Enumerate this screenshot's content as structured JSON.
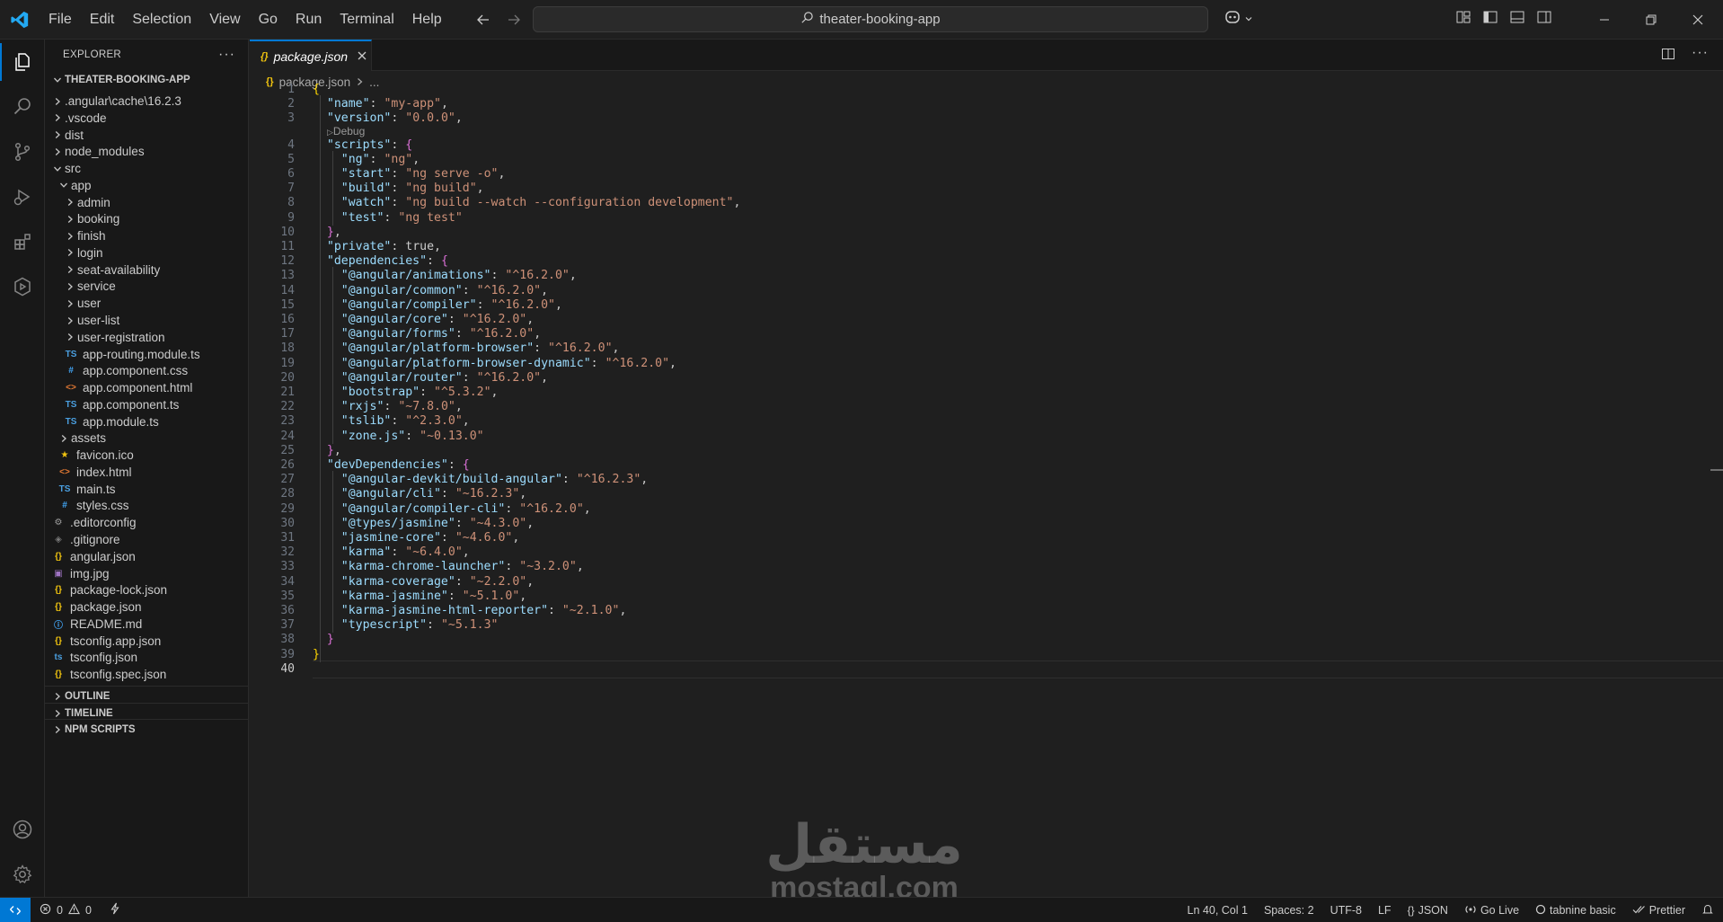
{
  "menu": [
    "File",
    "Edit",
    "Selection",
    "View",
    "Go",
    "Run",
    "Terminal",
    "Help"
  ],
  "command_center": {
    "text": "theater-booking-app"
  },
  "explorer": {
    "title": "EXPLORER",
    "root": "THEATER-BOOKING-APP",
    "tree": [
      {
        "label": ".angular\\cache\\16.2.3",
        "depth": 0,
        "kind": "folder",
        "open": false
      },
      {
        "label": ".vscode",
        "depth": 0,
        "kind": "folder",
        "open": false
      },
      {
        "label": "dist",
        "depth": 0,
        "kind": "folder",
        "open": false
      },
      {
        "label": "node_modules",
        "depth": 0,
        "kind": "folder",
        "open": false
      },
      {
        "label": "src",
        "depth": 0,
        "kind": "folder",
        "open": true
      },
      {
        "label": "app",
        "depth": 1,
        "kind": "folder",
        "open": true
      },
      {
        "label": "admin",
        "depth": 2,
        "kind": "folder",
        "open": false
      },
      {
        "label": "booking",
        "depth": 2,
        "kind": "folder",
        "open": false
      },
      {
        "label": "finish",
        "depth": 2,
        "kind": "folder",
        "open": false
      },
      {
        "label": "login",
        "depth": 2,
        "kind": "folder",
        "open": false
      },
      {
        "label": "seat-availability",
        "depth": 2,
        "kind": "folder",
        "open": false
      },
      {
        "label": "service",
        "depth": 2,
        "kind": "folder",
        "open": false
      },
      {
        "label": "user",
        "depth": 2,
        "kind": "folder",
        "open": false
      },
      {
        "label": "user-list",
        "depth": 2,
        "kind": "folder",
        "open": false
      },
      {
        "label": "user-registration",
        "depth": 2,
        "kind": "folder",
        "open": false
      },
      {
        "label": "app-routing.module.ts",
        "depth": 2,
        "kind": "ts"
      },
      {
        "label": "app.component.css",
        "depth": 2,
        "kind": "css"
      },
      {
        "label": "app.component.html",
        "depth": 2,
        "kind": "html"
      },
      {
        "label": "app.component.ts",
        "depth": 2,
        "kind": "ts"
      },
      {
        "label": "app.module.ts",
        "depth": 2,
        "kind": "ts"
      },
      {
        "label": "assets",
        "depth": 1,
        "kind": "folder",
        "open": false
      },
      {
        "label": "favicon.ico",
        "depth": 1,
        "kind": "star"
      },
      {
        "label": "index.html",
        "depth": 1,
        "kind": "html"
      },
      {
        "label": "main.ts",
        "depth": 1,
        "kind": "ts"
      },
      {
        "label": "styles.css",
        "depth": 1,
        "kind": "css"
      },
      {
        "label": ".editorconfig",
        "depth": 0,
        "kind": "gear"
      },
      {
        "label": ".gitignore",
        "depth": 0,
        "kind": "git"
      },
      {
        "label": "angular.json",
        "depth": 0,
        "kind": "json"
      },
      {
        "label": "img.jpg",
        "depth": 0,
        "kind": "img"
      },
      {
        "label": "package-lock.json",
        "depth": 0,
        "kind": "json"
      },
      {
        "label": "package.json",
        "depth": 0,
        "kind": "json"
      },
      {
        "label": "README.md",
        "depth": 0,
        "kind": "info"
      },
      {
        "label": "tsconfig.app.json",
        "depth": 0,
        "kind": "json"
      },
      {
        "label": "tsconfig.json",
        "depth": 0,
        "kind": "tsconfig"
      },
      {
        "label": "tsconfig.spec.json",
        "depth": 0,
        "kind": "json"
      }
    ],
    "sections": [
      "OUTLINE",
      "TIMELINE",
      "NPM SCRIPTS"
    ]
  },
  "tab": {
    "label": "package.json"
  },
  "breadcrumb": {
    "file": "package.json",
    "more": "..."
  },
  "codelens": "Debug",
  "code": [
    "{",
    "  \"name\": \"my-app\",",
    "  \"version\": \"0.0.0\",",
    "  \"scripts\": {",
    "    \"ng\": \"ng\",",
    "    \"start\": \"ng serve -o\",",
    "    \"build\": \"ng build\",",
    "    \"watch\": \"ng build --watch --configuration development\",",
    "    \"test\": \"ng test\"",
    "  },",
    "  \"private\": true,",
    "  \"dependencies\": {",
    "    \"@angular/animations\": \"^16.2.0\",",
    "    \"@angular/common\": \"^16.2.0\",",
    "    \"@angular/compiler\": \"^16.2.0\",",
    "    \"@angular/core\": \"^16.2.0\",",
    "    \"@angular/forms\": \"^16.2.0\",",
    "    \"@angular/platform-browser\": \"^16.2.0\",",
    "    \"@angular/platform-browser-dynamic\": \"^16.2.0\",",
    "    \"@angular/router\": \"^16.2.0\",",
    "    \"bootstrap\": \"^5.3.2\",",
    "    \"rxjs\": \"~7.8.0\",",
    "    \"tslib\": \"^2.3.0\",",
    "    \"zone.js\": \"~0.13.0\"",
    "  },",
    "  \"devDependencies\": {",
    "    \"@angular-devkit/build-angular\": \"^16.2.3\",",
    "    \"@angular/cli\": \"~16.2.3\",",
    "    \"@angular/compiler-cli\": \"^16.2.0\",",
    "    \"@types/jasmine\": \"~4.3.0\",",
    "    \"jasmine-core\": \"~4.6.0\",",
    "    \"karma\": \"~6.4.0\",",
    "    \"karma-chrome-launcher\": \"~3.2.0\",",
    "    \"karma-coverage\": \"~2.2.0\",",
    "    \"karma-jasmine\": \"~5.1.0\",",
    "    \"karma-jasmine-html-reporter\": \"~2.1.0\",",
    "    \"typescript\": \"~5.1.3\"",
    "  }",
    "}",
    ""
  ],
  "current_line": 40,
  "watermark": {
    "arabic": "مستقل",
    "latin": "mostaql.com"
  },
  "status": {
    "errors": "0",
    "warnings": "0",
    "position": "Ln 40, Col 1",
    "spaces": "Spaces: 2",
    "encoding": "UTF-8",
    "eol": "LF",
    "language": "JSON",
    "golive": "Go Live",
    "tabnine": "tabnine basic",
    "prettier": "Prettier"
  },
  "colors": {
    "accent": "#0078d4",
    "folder_icon": "#c5c5c5",
    "json_icon": "#f1c40f",
    "ts_icon": "#4a9fe0",
    "html_icon": "#e37933",
    "css_icon": "#42a5f5"
  }
}
